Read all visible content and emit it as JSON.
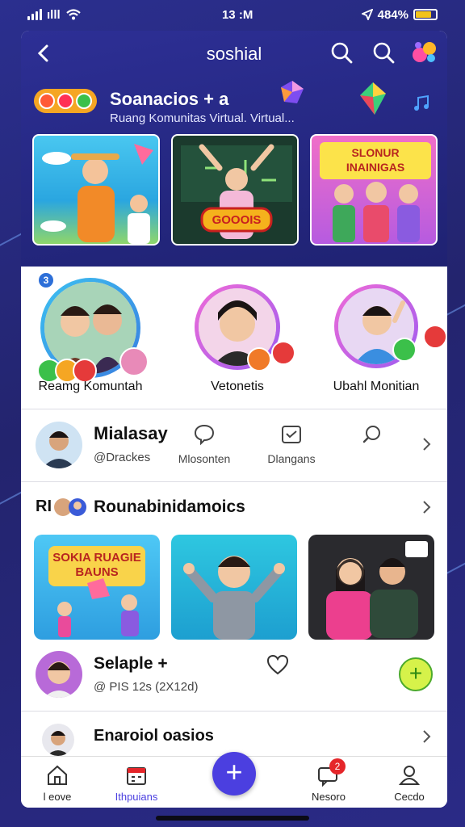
{
  "status_bar": {
    "carrier_text": "ılll",
    "time": "13 :M",
    "battery_text": "484%"
  },
  "nav": {
    "title": "soshial"
  },
  "community": {
    "name": "Soanacios + a",
    "subtitle": "Ruang Komunitas Virtual. Virtual..."
  },
  "banners": [
    {
      "caption": ""
    },
    {
      "caption": "GOOOIS"
    },
    {
      "caption": "SLONUR INAINIGAS"
    }
  ],
  "groups": [
    {
      "label": "Reamg Komuntah",
      "count_badge": "3"
    },
    {
      "label": "Vetonetis"
    },
    {
      "label": "Ubahl Monitian"
    }
  ],
  "profile_row": {
    "name": "Mialasay",
    "handle": "@Drackes",
    "actions": [
      {
        "label": "Mlosonten",
        "icon": "chat-bubble-icon"
      },
      {
        "label": "Dlangans",
        "icon": "inbox-icon"
      },
      {
        "label": "",
        "icon": "search-bubble-icon"
      }
    ]
  },
  "feed": {
    "prefix": "RI",
    "title": "Rounabinidamoics",
    "thumbs": [
      {
        "caption": "SOKIA RUAGIE BAUNS"
      },
      {
        "caption": ""
      },
      {
        "caption": ""
      }
    ]
  },
  "post": {
    "name": "Selaple +",
    "meta": "@ PIS 12s (2X12d)"
  },
  "more": {
    "name": "Enaroiol oasios"
  },
  "tabbar": {
    "tabs": [
      {
        "label": "l eove",
        "icon": "home-icon"
      },
      {
        "label": "Ithpuians",
        "icon": "calendar-icon"
      },
      {
        "label": "Nesoro",
        "icon": "message-icon",
        "badge": "2"
      },
      {
        "label": "Cecdo",
        "icon": "profile-icon"
      }
    ],
    "fab_label": "+"
  },
  "colors": {
    "header_bg": "#2d2f95",
    "accent": "#4b3fe0",
    "tab_active": "#4b3fe0",
    "notification": "#e5262a"
  }
}
